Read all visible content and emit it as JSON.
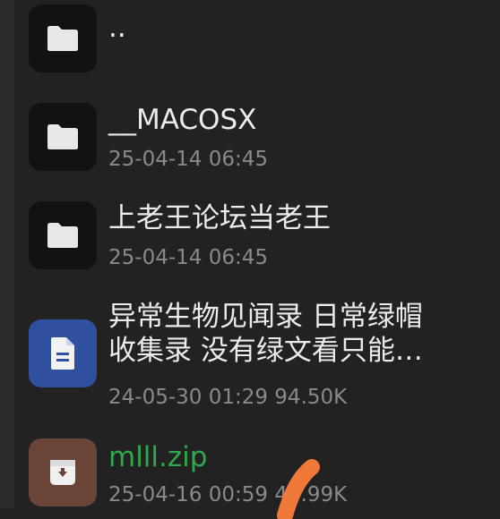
{
  "colors": {
    "background": "#222222",
    "folder_tile": "#121212",
    "doc_tile": "#2f4f9f",
    "zip_tile": "#6b4438",
    "zip_name": "#2fa84a",
    "gesture": "#f0793a"
  },
  "files": [
    {
      "name": "..",
      "meta": "",
      "icon": "folder-icon"
    },
    {
      "name": "__MACOSX",
      "meta": "25-04-14 06:45",
      "icon": "folder-icon"
    },
    {
      "name": "上老王论坛当老王",
      "meta": "25-04-14 06:45",
      "icon": "folder-icon"
    },
    {
      "name_line1": "异常生物见闻录 日常绿帽",
      "name_line2": "收集录 没有绿文看只能…",
      "meta": "24-05-30 01:29  94.50K",
      "icon": "document-icon"
    },
    {
      "name": "mlll.zip",
      "meta": "25-04-16 00:59  48.99K",
      "icon": "archive-icon"
    }
  ]
}
